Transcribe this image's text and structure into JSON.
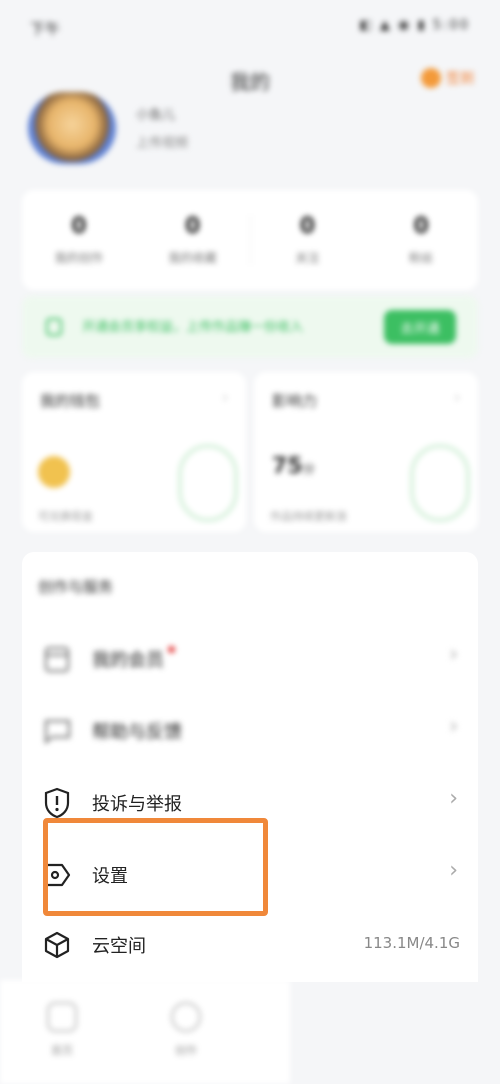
{
  "status_bar": {
    "time": "下午",
    "icons": "◧ ▲ ◉ ▮ 5:00"
  },
  "header": {
    "title": "我的",
    "signin_label": "签到"
  },
  "profile": {
    "name": "小鱼儿",
    "subtitle": "上传视频"
  },
  "stats": [
    {
      "value": "0",
      "label": "我的创作"
    },
    {
      "value": "0",
      "label": "我的收藏"
    },
    {
      "value": "0",
      "label": "关注"
    },
    {
      "value": "0",
      "label": "粉丝"
    }
  ],
  "banner": {
    "text": "开通会员享权益，上传作品赚一份收入",
    "button": "去开通"
  },
  "cards": {
    "left": {
      "title": "我的钱包",
      "chevron": "›",
      "desc": "可兑换现金"
    },
    "right": {
      "title": "影响力",
      "chevron": "›",
      "value": "75",
      "unit": "分",
      "desc": "作品持续更新涨"
    }
  },
  "menu": {
    "section_title": "创作与服务",
    "items": [
      {
        "label": "我的会员",
        "chevron": "›"
      },
      {
        "label": "帮助与反馈",
        "chevron": "›"
      },
      {
        "label": "投诉与举报",
        "chevron": "›"
      },
      {
        "label": "设置",
        "chevron": "›"
      },
      {
        "label": "云空间",
        "detail": "113.1M/4.1G"
      }
    ]
  },
  "bottom_nav": [
    {
      "label": "首页"
    },
    {
      "label": "创作"
    }
  ],
  "colors": {
    "accent_green": "#3cbf62",
    "highlight_orange": "#f0883a"
  }
}
